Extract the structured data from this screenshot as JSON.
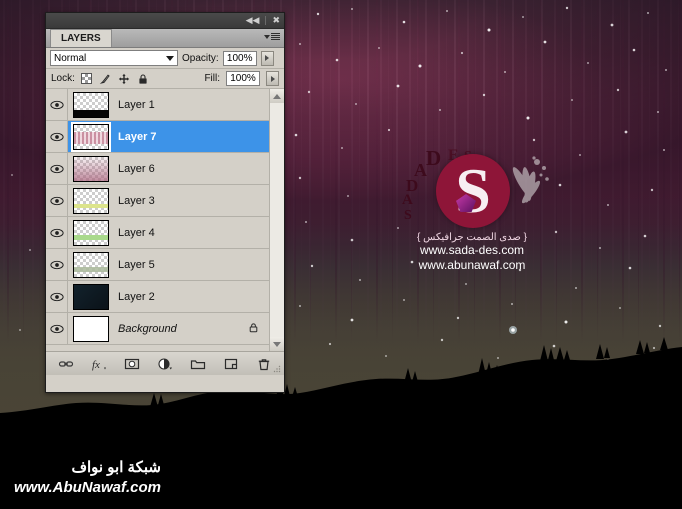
{
  "panel": {
    "titlebar": {
      "collapse_icon": "collapse-double-arrow-icon",
      "close_icon": "close-icon"
    },
    "tab_label": "LAYERS",
    "menu_icon": "panel-menu-icon",
    "blend_mode": "Normal",
    "opacity_label": "Opacity:",
    "opacity_value": "100%",
    "lock_label": "Lock:",
    "lock_icons": [
      "lock-transparency-icon",
      "lock-image-pixels-icon",
      "lock-position-icon",
      "lock-all-icon"
    ],
    "fill_label": "Fill:",
    "fill_value": "100%",
    "layers": [
      {
        "name": "Layer 1",
        "visible": true,
        "selected": false,
        "locked": false,
        "thumb": "transparent-black-band"
      },
      {
        "name": "Layer 7",
        "visible": true,
        "selected": true,
        "locked": false,
        "thumb": "pink-streaks"
      },
      {
        "name": "Layer 6",
        "visible": true,
        "selected": false,
        "locked": false,
        "thumb": "pink-soft"
      },
      {
        "name": "Layer 3",
        "visible": true,
        "selected": false,
        "locked": false,
        "thumb": "yellow-band"
      },
      {
        "name": "Layer 4",
        "visible": true,
        "selected": false,
        "locked": false,
        "thumb": "green-band"
      },
      {
        "name": "Layer 5",
        "visible": true,
        "selected": false,
        "locked": false,
        "thumb": "gray-green-band"
      },
      {
        "name": "Layer 2",
        "visible": true,
        "selected": false,
        "locked": false,
        "thumb": "dark-navy"
      },
      {
        "name": "Background",
        "visible": true,
        "selected": false,
        "locked": true,
        "thumb": "white"
      }
    ],
    "bottom_buttons": [
      "link-layers-icon",
      "layer-style-fx-icon",
      "add-layer-mask-icon",
      "new-adjustment-layer-icon",
      "new-group-icon",
      "new-layer-icon",
      "delete-layer-icon"
    ]
  },
  "watermark": {
    "brand_letters": [
      "D",
      "E",
      "S",
      "A",
      "D",
      "A",
      "S"
    ],
    "monogram": "S",
    "arabic_tagline": "{ صدى الصمت جرافيكس }",
    "url1": "www.sada-des.com",
    "url2": "www.abunawaf.com"
  },
  "branding": {
    "arabic": "شبكة ابو نواف",
    "url": "www.AbuNawaf.com"
  },
  "colors": {
    "selection_blue": "#3d93e8",
    "panel_gray": "#d4d0c8",
    "aurora_green": "#cbe77e",
    "sky_magenta": "#a33f63",
    "logo_maroon": "#8e1538"
  }
}
